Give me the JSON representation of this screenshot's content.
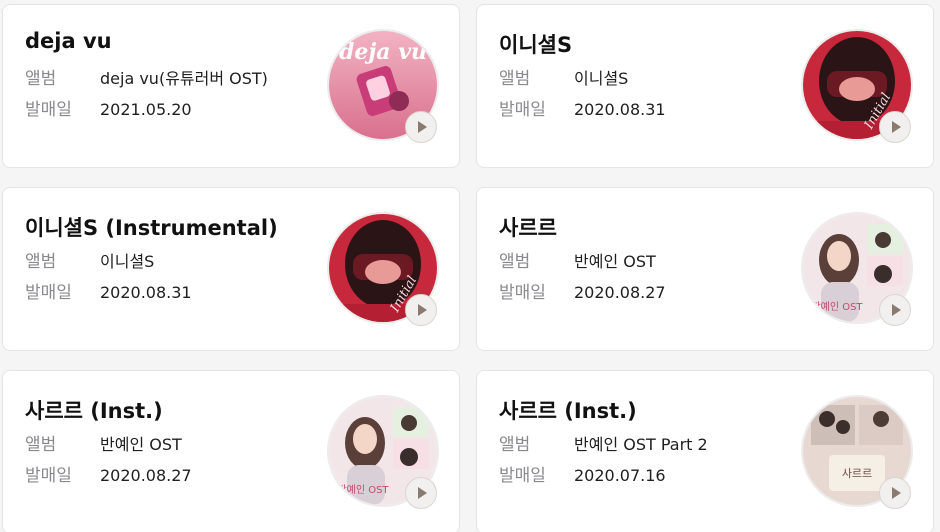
{
  "labels": {
    "album": "앨범",
    "release": "발매일"
  },
  "songs": [
    {
      "title": "deja vu",
      "album": "deja vu(유튜러버 OST)",
      "release_date": "2021.05.20",
      "cover_text": "deja vu"
    },
    {
      "title": "이니셜S",
      "album": "이니셜S",
      "release_date": "2020.08.31",
      "cover_text": "Initial"
    },
    {
      "title": "이니셜S (Instrumental)",
      "album": "이니셜S",
      "release_date": "2020.08.31",
      "cover_text": "Initial"
    },
    {
      "title": "사르르",
      "album": "반예인 OST",
      "release_date": "2020.08.27",
      "cover_text": "반예인 OST"
    },
    {
      "title": "사르르 (Inst.)",
      "album": "반예인 OST",
      "release_date": "2020.08.27",
      "cover_text": "반예인 OST"
    },
    {
      "title": "사르르 (Inst.)",
      "album": "반예인 OST Part 2",
      "release_date": "2020.07.16",
      "cover_text": "사르르"
    }
  ],
  "colors": {
    "accent_play": "#8a7b70",
    "cover_dejavu": "#e8a0b4",
    "cover_initial": "#c8283c",
    "cover_banyein": "#f3e6e9",
    "cover_part2": "#e7d8d2"
  },
  "icons": {
    "play": "play-icon"
  }
}
